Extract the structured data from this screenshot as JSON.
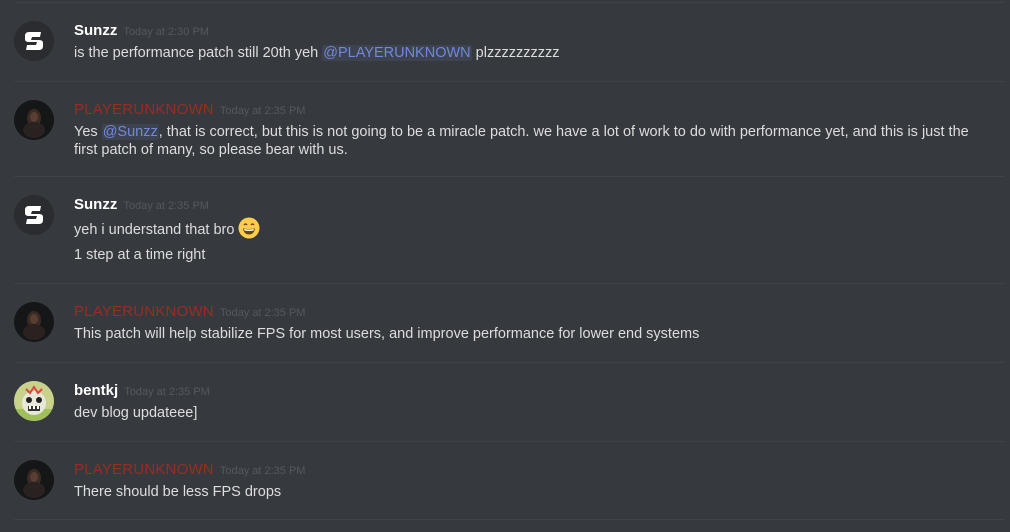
{
  "messages": [
    {
      "author": "Sunzz",
      "timestamp": "Today at 2:30 PM",
      "lines": [
        {
          "pre": "is the performance patch still 20th yeh ",
          "mention": "@PLAYERUNKNOWN",
          "post": " plzzzzzzzzzz"
        }
      ]
    },
    {
      "author": "PLAYERUNKNOWN",
      "timestamp": "Today at 2:35 PM",
      "lines": [
        {
          "pre": "Yes ",
          "mention": "@Sunzz",
          "post": ", that is correct, but this is not going to be a miracle patch. we have a lot of work to do with performance yet, and this is just the first patch of many, so please bear with us."
        }
      ]
    },
    {
      "author": "Sunzz",
      "timestamp": "Today at 2:35 PM",
      "lines": [
        {
          "text": "yeh i understand that bro",
          "emoji": "grinning-face-emoji"
        },
        {
          "text": "1 step at a time right"
        }
      ]
    },
    {
      "author": "PLAYERUNKNOWN",
      "timestamp": "Today at 2:35 PM",
      "lines": [
        {
          "text": "This patch will help stabilize FPS for most users, and improve performance for lower end systems"
        }
      ]
    },
    {
      "author": "bentkj",
      "timestamp": "Today at 2:35 PM",
      "lines": [
        {
          "text": "dev blog updateee]"
        }
      ]
    },
    {
      "author": "PLAYERUNKNOWN",
      "timestamp": "Today at 2:35 PM",
      "lines": [
        {
          "text": "There should be less FPS drops"
        }
      ]
    }
  ],
  "colors": {
    "background": "#36393e",
    "username_default": "#ffffff",
    "username_role": "#992d22",
    "mention": "#7289da",
    "timestamp": "#55585e",
    "text": "#dcddde"
  },
  "icons": {
    "sunzz_avatar": "sunzz-logo-icon",
    "playerunknown_avatar": "playerunknown-avatar-icon",
    "bentkj_avatar": "bentkj-avatar-icon"
  }
}
